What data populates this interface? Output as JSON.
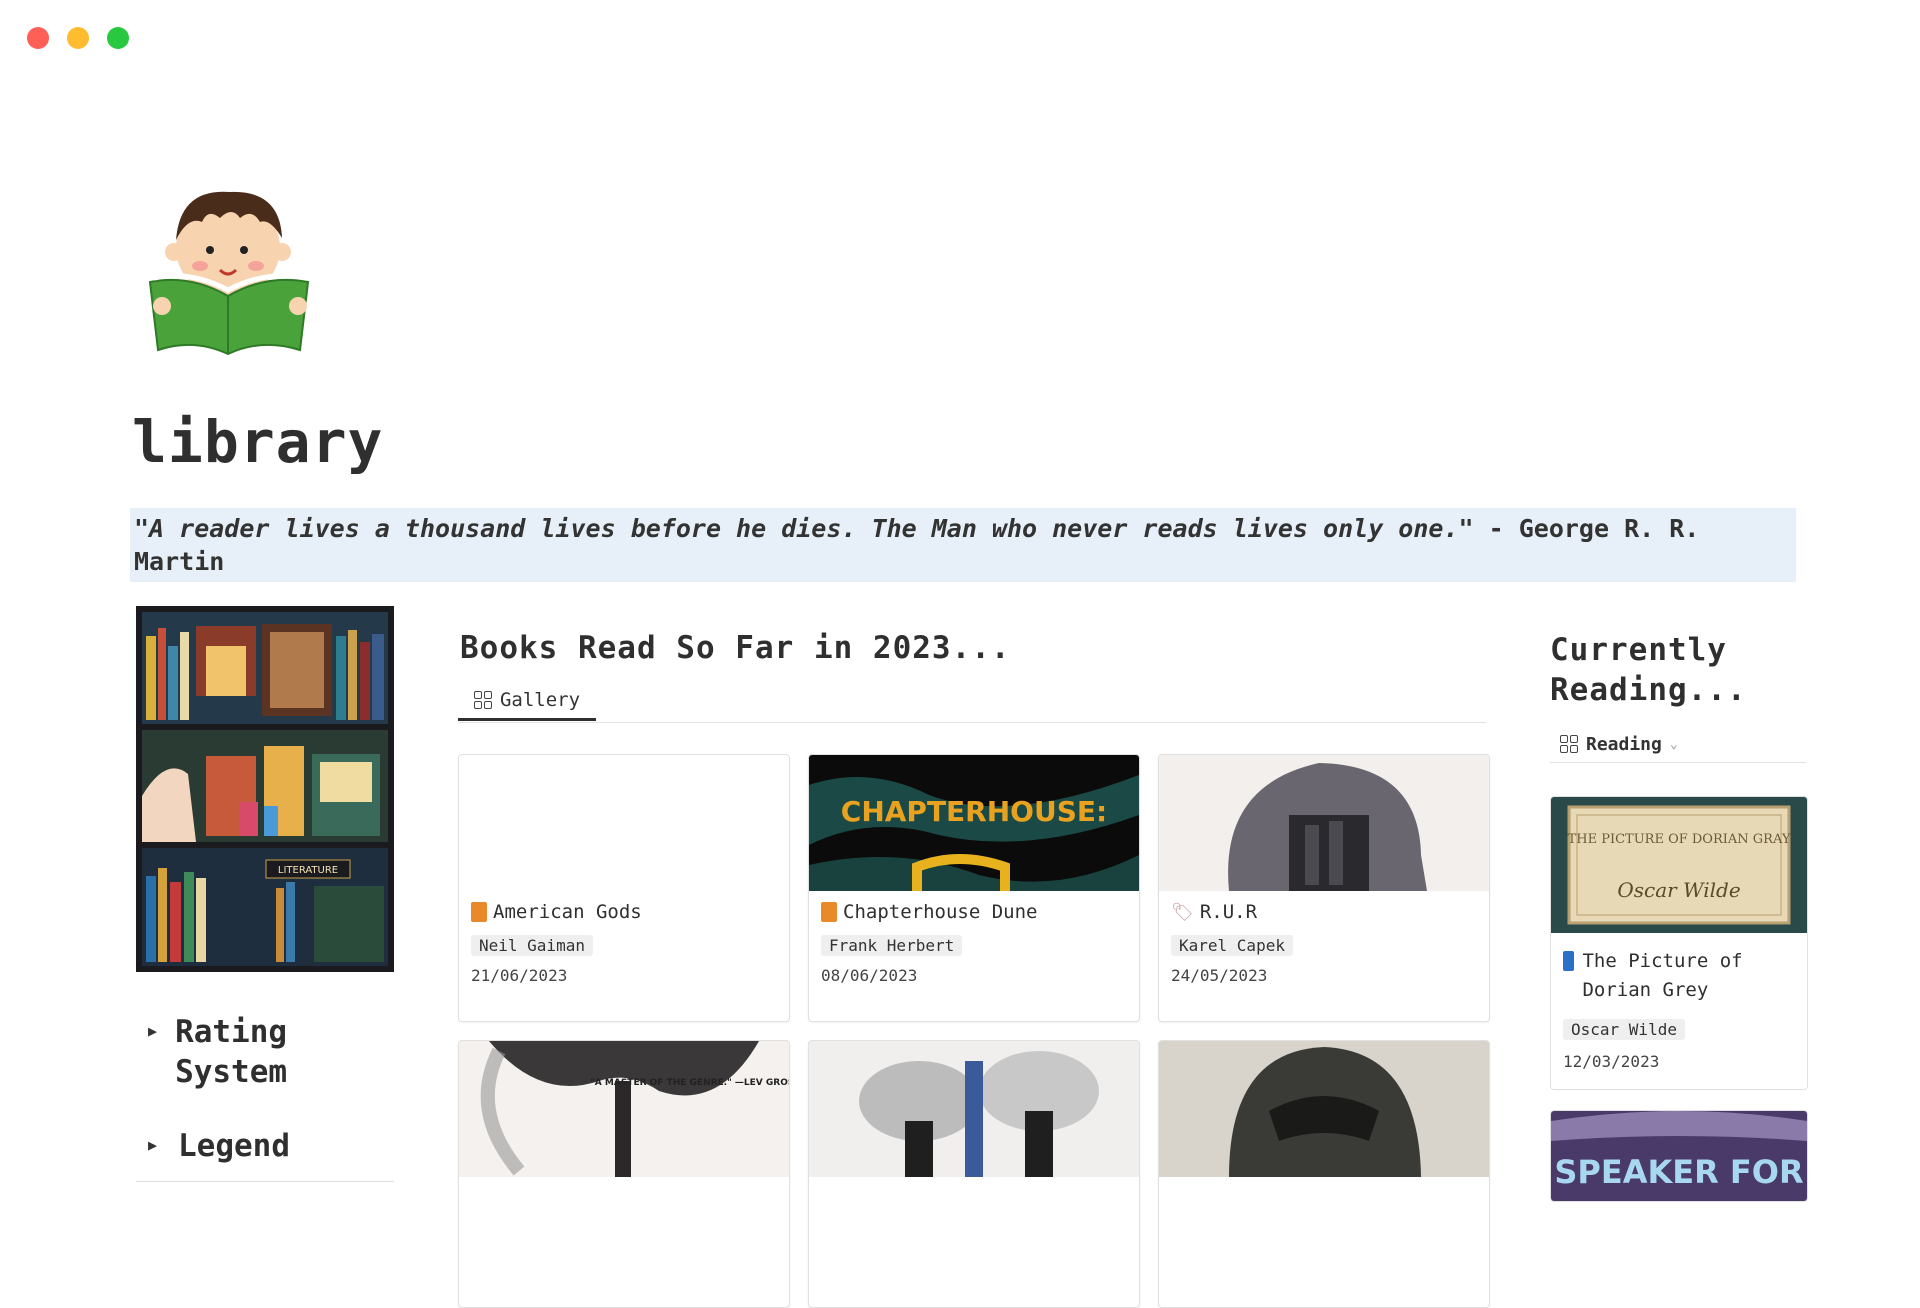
{
  "window": {
    "controls": [
      "close",
      "minimize",
      "maximize"
    ]
  },
  "page": {
    "title": "library",
    "quote_text": "\"A reader lives a thousand lives before he dies. The Man who never reads lives only one.\"",
    "quote_author": " - George R. R. Martin"
  },
  "sidebar": {
    "toggles": [
      {
        "label": "Rating System"
      },
      {
        "label": "Legend"
      }
    ]
  },
  "books_read": {
    "title": "Books Read So Far in 2023...",
    "view_tab": "Gallery",
    "cards": [
      {
        "title": "American Gods",
        "author": "Neil Gaiman",
        "date": "21/06/2023",
        "icon": "orange-book-icon",
        "cover_text": ""
      },
      {
        "title": "Chapterhouse Dune",
        "author": "Frank Herbert",
        "date": "08/06/2023",
        "icon": "orange-book-icon",
        "cover_text": "CHAPTERHOUSE:"
      },
      {
        "title": "R.U.R",
        "author": "Karel Capek",
        "date": "24/05/2023",
        "icon": "tag-icon",
        "cover_text": ""
      },
      {
        "cover_text": "\"A MASTER OF THE GENRE.\" —LEV GROSSMAN"
      }
    ]
  },
  "currently_reading": {
    "title": "Currently Reading...",
    "view_tab": "Reading",
    "cards": [
      {
        "title": "The Picture of Dorian Grey",
        "author": "Oscar Wilde",
        "date": "12/03/2023",
        "icon": "blue-book-icon",
        "cover_title": "THE PICTURE OF DORIAN GRAY",
        "cover_author": "Oscar Wilde"
      },
      {
        "cover_text": "SPEAKER FOR"
      }
    ]
  },
  "colors": {
    "quote_bg": "#e7f0f8",
    "accent_dark": "#2f2f2f",
    "tag_bg": "#efefef"
  }
}
